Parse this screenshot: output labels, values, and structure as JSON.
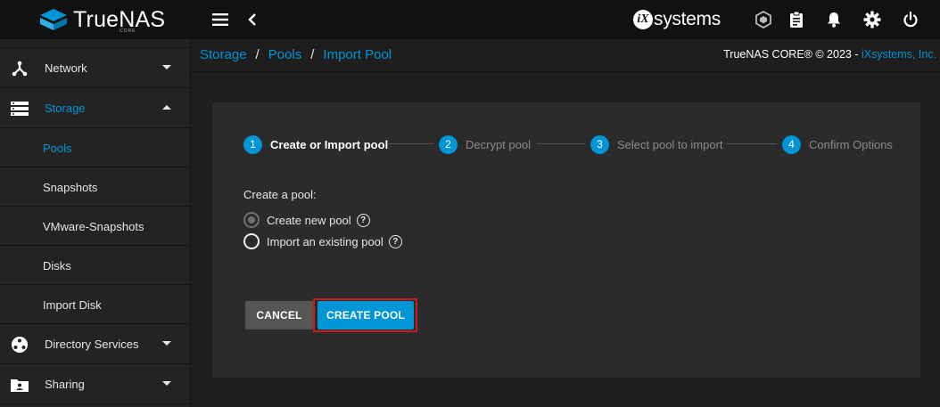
{
  "header": {
    "brand": "TrueNAS",
    "brand_sub": "CORE",
    "vendor_mark": "iX",
    "vendor_text": "systems",
    "icons": [
      "menu-icon",
      "chevron-left-icon",
      "truecommand-icon",
      "clipboard-icon",
      "bell-icon",
      "gear-icon",
      "power-icon"
    ]
  },
  "sidebar": {
    "items": [
      {
        "label": "Network",
        "icon": "network-icon"
      },
      {
        "label": "Storage",
        "icon": "storage-icon"
      },
      {
        "label": "Directory Services",
        "icon": "directory-icon"
      },
      {
        "label": "Sharing",
        "icon": "sharing-icon"
      }
    ],
    "storage_sub": [
      {
        "label": "Pools"
      },
      {
        "label": "Snapshots"
      },
      {
        "label": "VMware-Snapshots"
      },
      {
        "label": "Disks"
      },
      {
        "label": "Import Disk"
      }
    ]
  },
  "breadcrumb": [
    "Storage",
    "Pools",
    "Import Pool"
  ],
  "copyright": {
    "text": "TrueNAS CORE® © 2023 - ",
    "company": "iXsystems, Inc."
  },
  "wizard": {
    "steps": [
      {
        "num": "1",
        "label": "Create or Import pool"
      },
      {
        "num": "2",
        "label": "Decrypt pool"
      },
      {
        "num": "3",
        "label": "Select pool to import"
      },
      {
        "num": "4",
        "label": "Confirm Options"
      }
    ],
    "section_label": "Create a pool:",
    "options": [
      {
        "label": "Create new pool",
        "checked": true
      },
      {
        "label": "Import an existing pool",
        "checked": false
      }
    ],
    "help_glyph": "?",
    "cancel_label": "CANCEL",
    "create_label": "CREATE POOL"
  },
  "colors": {
    "accent": "#0095d5",
    "highlight": "#d01a1a"
  }
}
